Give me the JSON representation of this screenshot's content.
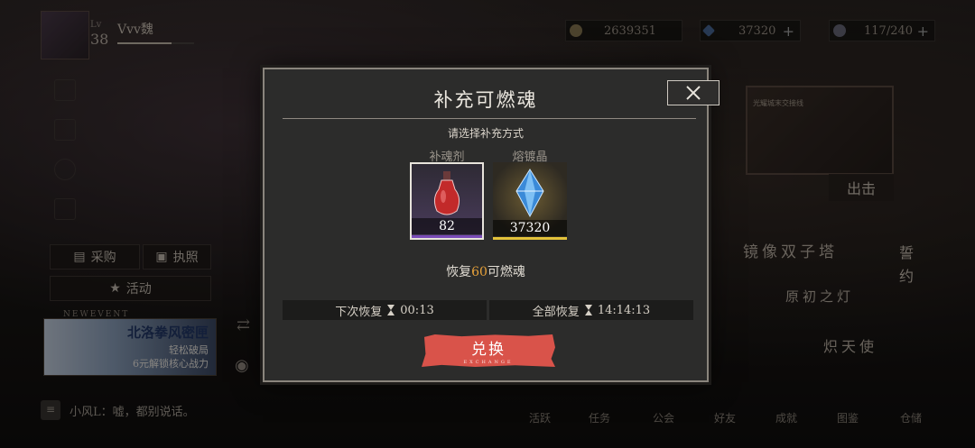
{
  "player": {
    "level_label": "Lv",
    "level": "38",
    "name": "Vvv魏"
  },
  "resources": [
    {
      "icon": "gold-coin-icon",
      "value": "2639351",
      "has_plus": false
    },
    {
      "icon": "crystal-icon",
      "value": "37320",
      "has_plus": true
    },
    {
      "icon": "soul-flame-icon",
      "value": "117/240",
      "has_plus": true
    }
  ],
  "left_menu": {
    "shop": "采购",
    "license": "执照",
    "activity": "活动"
  },
  "event_banner": {
    "tag": "NEWEVENT",
    "title": "北洛拳风密匣",
    "line1": "轻松破局",
    "line2": "6元解锁核心战力"
  },
  "chat": {
    "message": "小风L：嘘，都别说话。"
  },
  "right_menu": {
    "frame_caption": "光耀城末交接线",
    "exit": "出击",
    "mirror_tower": "镜像双子塔",
    "oath": "誓约",
    "origin_lamp": "原初之灯",
    "angel": "炽天使"
  },
  "bottom_nav": [
    "活跃",
    "任务",
    "公会",
    "好友",
    "成就",
    "图鉴",
    "仓储"
  ],
  "modal": {
    "title": "补充可燃魂",
    "subtitle": "请选择补充方式",
    "options": [
      {
        "label": "补魂剂",
        "count": "82",
        "icon": "red-potion-icon",
        "bar_color": "#7a4bb8",
        "selected": true
      },
      {
        "label": "熔镀晶",
        "count": "37320",
        "icon": "blue-crystal-icon",
        "bar_color": "#e3c23a",
        "selected": false
      }
    ],
    "restore_prefix": "恢复",
    "restore_amount": "60",
    "restore_suffix": "可燃魂",
    "next_restore_label": "下次恢复",
    "next_restore_time": "00:13",
    "full_restore_label": "全部恢复",
    "full_restore_time": "14:14:13",
    "exchange_label": "兑换",
    "exchange_sub": "EXCHANGE"
  },
  "colors": {
    "accent_orange": "#e8a23a",
    "exchange_red": "#d9534a",
    "modal_bg": "#2c2c2b"
  }
}
